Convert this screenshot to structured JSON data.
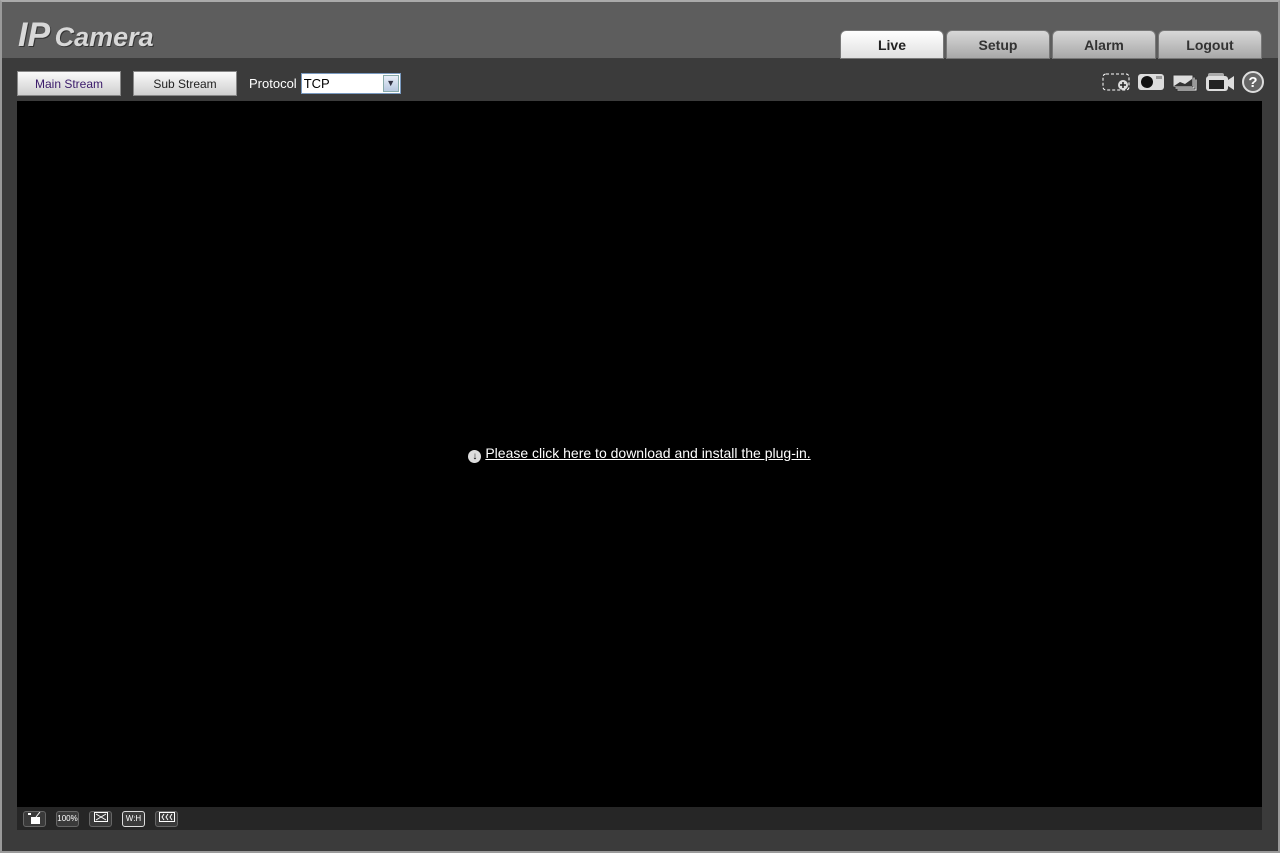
{
  "header": {
    "logo_ip": "IP",
    "logo_camera": "Camera",
    "tabs": [
      {
        "label": "Live",
        "active": true
      },
      {
        "label": "Setup"
      },
      {
        "label": "Alarm"
      },
      {
        "label": "Logout"
      }
    ]
  },
  "toolbar": {
    "main_stream": "Main Stream",
    "sub_stream": "Sub Stream",
    "protocol_label": "Protocol",
    "protocol_value": "TCP"
  },
  "right_icons": [
    "zoom-region-icon",
    "snapshot-icon",
    "triple-snapshot-icon",
    "record-icon",
    "help-icon"
  ],
  "video": {
    "plugin_link": "Please click here to download and install the plug-in."
  },
  "bottom": {
    "original_size": "100%",
    "ratio": "W:H"
  }
}
